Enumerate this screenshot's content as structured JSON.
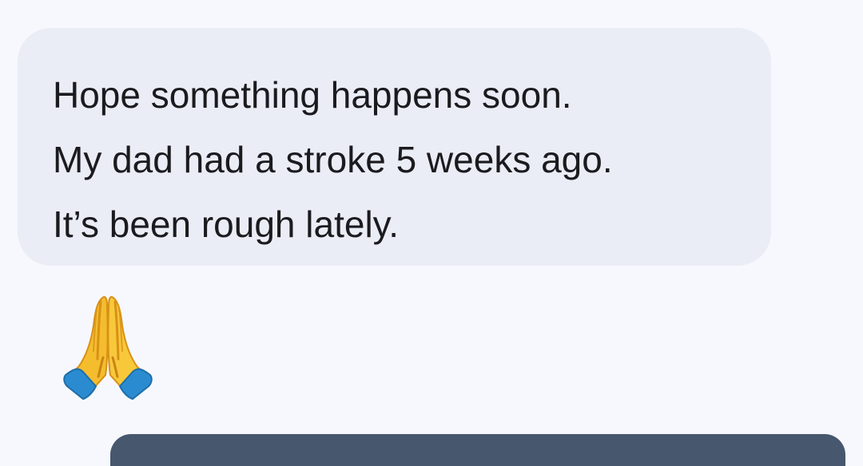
{
  "conversation": {
    "incoming_message": {
      "lines": [
        "Hope something happens soon.",
        "My dad had a stroke 5 weeks ago.",
        "It’s been rough lately."
      ]
    },
    "emoji_message": {
      "icon": "folded-hands-icon"
    }
  },
  "colors": {
    "background": "#f7f8fd",
    "bubble": "#eaedf5",
    "text": "#1b1b1f",
    "bottom_card": "#46576e"
  }
}
